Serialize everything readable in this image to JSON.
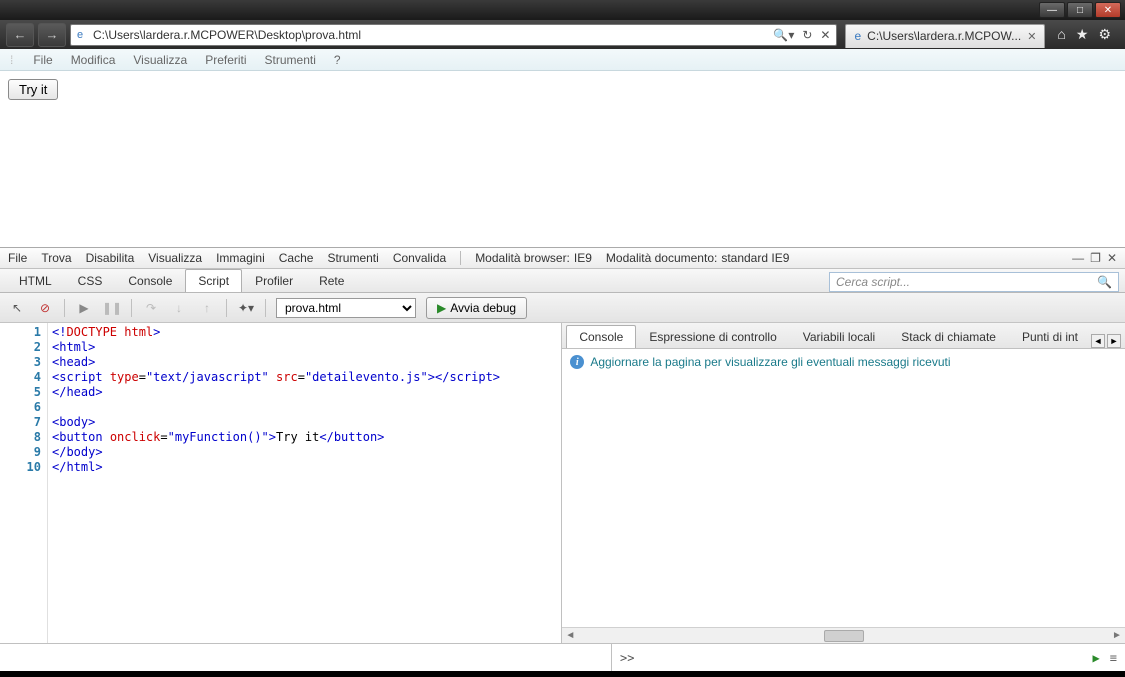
{
  "window": {
    "tab_title": "C:\\Users\\lardera.r.MCPOW...",
    "address": "C:\\Users\\lardera.r.MCPOWER\\Desktop\\prova.html"
  },
  "page_menu": [
    "File",
    "Modifica",
    "Visualizza",
    "Preferiti",
    "Strumenti",
    "?"
  ],
  "page": {
    "try_it": "Try it"
  },
  "dev": {
    "menu": [
      "File",
      "Trova",
      "Disabilita",
      "Visualizza",
      "Immagini",
      "Cache",
      "Strumenti",
      "Convalida"
    ],
    "browser_mode_label": "Modalità browser:",
    "browser_mode_value": "IE9",
    "doc_mode_label": "Modalità documento:",
    "doc_mode_value": "standard IE9",
    "tabs": [
      "HTML",
      "CSS",
      "Console",
      "Script",
      "Profiler",
      "Rete"
    ],
    "active_tab": "Script",
    "search_placeholder": "Cerca script...",
    "file_selected": "prova.html",
    "debug_button": "Avvia debug",
    "right_tabs": [
      "Console",
      "Espressione di controllo",
      "Variabili locali",
      "Stack di chiamate",
      "Punti di int"
    ],
    "active_right_tab": "Console",
    "console_message": "Aggiornare la pagina per visualizzare gli eventuali messaggi ricevuti",
    "prompt": ">>"
  },
  "code": {
    "lines": [
      {
        "n": 1,
        "html": "&lt;!DOCTYPE html&gt;"
      },
      {
        "n": 2,
        "html": "<span class='tag'>&lt;html&gt;</span>"
      },
      {
        "n": 3,
        "html": "<span class='tag'>&lt;head&gt;</span>"
      },
      {
        "n": 4,
        "html": "<span class='tag'>&lt;script</span> <span class='attr'>type</span>=<span class='val'>\"text/javascript\"</span> <span class='attr'>src</span>=<span class='val'>\"detailevento.js\"</span><span class='tag'>&gt;&lt;/script&gt;</span>"
      },
      {
        "n": 5,
        "html": "<span class='tag'>&lt;/head&gt;</span>"
      },
      {
        "n": 6,
        "html": ""
      },
      {
        "n": 7,
        "html": "<span class='tag'>&lt;body&gt;</span>"
      },
      {
        "n": 8,
        "html": "<span class='tag'>&lt;button</span> <span class='attr'>onclick</span>=<span class='val'>\"myFunction()\"</span><span class='tag'>&gt;</span><span class='plain'>Try it</span><span class='tag'>&lt;/button&gt;</span>"
      },
      {
        "n": 9,
        "html": "<span class='tag'>&lt;/body&gt;</span>"
      },
      {
        "n": 10,
        "html": "<span class='tag'>&lt;/html&gt;</span>"
      }
    ]
  }
}
